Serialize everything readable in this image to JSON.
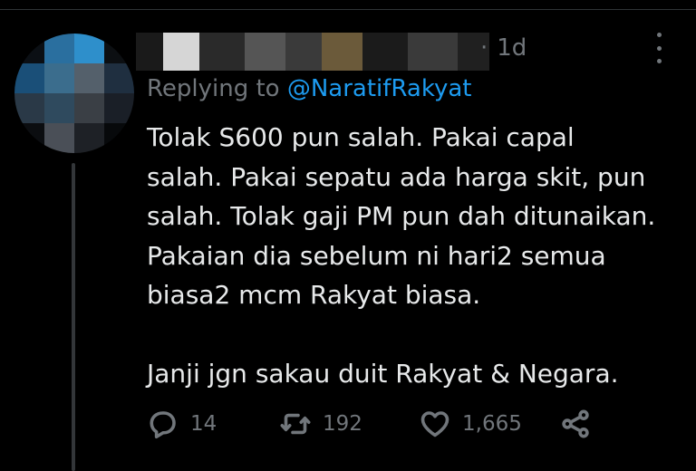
{
  "tweet": {
    "timestamp": "1d",
    "replying_prefix": "Replying to ",
    "replying_handle": "@NaratifRakyat",
    "text": "Tolak S600 pun salah. Pakai capal\nsalah. Pakai sepatu ada harga skit, pun\nsalah. Tolak gaji PM pun dah ditunaikan.\nPakaian dia sebelum ni hari2 semua\nbiasa2 mcm Rakyat biasa.\n\nJanji jgn sakau duit Rakyat & Negara."
  },
  "actions": {
    "reply_count": "14",
    "retweet_count": "192",
    "like_count": "1,665"
  },
  "icons": {
    "more": "more-icon",
    "reply": "reply-icon",
    "retweet": "retweet-icon",
    "like": "heart-icon",
    "share": "share-icon"
  },
  "colors": {
    "background": "#000000",
    "text": "#e7e9ea",
    "muted": "#71767b",
    "link": "#1d9bf0"
  }
}
